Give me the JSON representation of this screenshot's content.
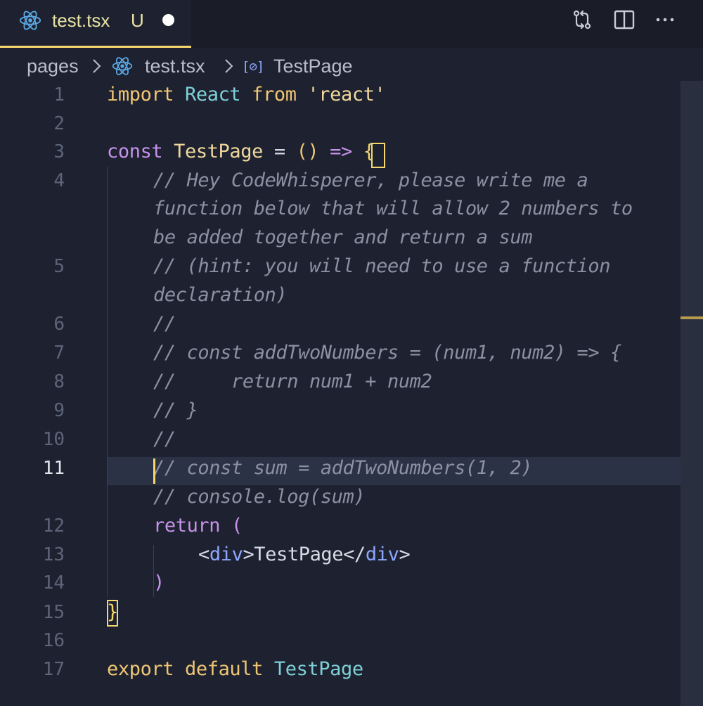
{
  "tab": {
    "filename": "test.tsx",
    "status": "U"
  },
  "breadcrumb": {
    "folder": "pages",
    "file": "test.tsx",
    "symbol": "TestPage",
    "symbol_icon": "[⊘]"
  },
  "toolbar": {
    "compare_icon": "git-compare-icon",
    "split_icon": "split-editor-icon",
    "more_icon": "more-actions-icon"
  },
  "colors": {
    "accent": "#f5d76e",
    "background": "#1e2230",
    "tabbar": "#1a1d27",
    "comment": "#8b91a3"
  },
  "editor": {
    "active_line": "11",
    "lines": [
      {
        "num": "1",
        "tokens": [
          [
            "import",
            "kw"
          ],
          [
            " ",
            "tx"
          ],
          [
            "React",
            "ty"
          ],
          [
            " ",
            "tx"
          ],
          [
            "from",
            "kw"
          ],
          [
            " ",
            "tx"
          ],
          [
            "'react'",
            "st"
          ]
        ]
      },
      {
        "num": "2",
        "tokens": []
      },
      {
        "num": "3",
        "tokens": [
          [
            "const",
            "pl"
          ],
          [
            " ",
            "tx"
          ],
          [
            "TestPage",
            "id"
          ],
          [
            " = ",
            "tx"
          ],
          [
            "()",
            "kw"
          ],
          [
            " => ",
            "pl"
          ],
          [
            "{",
            "br"
          ]
        ]
      },
      {
        "num": "4",
        "tokens": [
          [
            "// Hey CodeWhisperer, please write me a",
            "cm"
          ]
        ]
      },
      {
        "num": "",
        "tokens": [
          [
            "function below that will allow 2 numbers to",
            "cm"
          ]
        ]
      },
      {
        "num": "",
        "tokens": [
          [
            "be added together and return a sum",
            "cm"
          ]
        ]
      },
      {
        "num": "5",
        "tokens": [
          [
            "// (hint: you will need to use a function",
            "cm"
          ]
        ]
      },
      {
        "num": "",
        "tokens": [
          [
            "declaration)",
            "cm"
          ]
        ]
      },
      {
        "num": "6",
        "tokens": [
          [
            "//",
            "cm"
          ]
        ]
      },
      {
        "num": "7",
        "tokens": [
          [
            "// const addTwoNumbers = (num1, num2) => {",
            "cm"
          ]
        ]
      },
      {
        "num": "8",
        "tokens": [
          [
            "//     return num1 + num2",
            "cm"
          ]
        ]
      },
      {
        "num": "9",
        "tokens": [
          [
            "// }",
            "cm"
          ]
        ]
      },
      {
        "num": "10",
        "tokens": [
          [
            "//",
            "cm"
          ]
        ]
      },
      {
        "num": "11",
        "tokens": [
          [
            "// const sum = addTwoNumbers(1, 2)",
            "cm"
          ]
        ]
      },
      {
        "num": "",
        "tokens": [
          [
            "// console.log(sum)",
            "cm"
          ]
        ]
      },
      {
        "num": "12",
        "tokens": [
          [
            "return",
            "pl"
          ],
          [
            " ",
            "tx"
          ],
          [
            "(",
            "pl"
          ]
        ]
      },
      {
        "num": "13",
        "tokens": [
          [
            "<",
            "tx"
          ],
          [
            "div",
            "tg"
          ],
          [
            ">TestPage</",
            "tx"
          ],
          [
            "div",
            "tg"
          ],
          [
            ">",
            "tx"
          ]
        ]
      },
      {
        "num": "14",
        "tokens": [
          [
            ")",
            "pl"
          ]
        ]
      },
      {
        "num": "15",
        "tokens": [
          [
            "}",
            "br"
          ]
        ]
      },
      {
        "num": "16",
        "tokens": []
      },
      {
        "num": "17",
        "tokens": [
          [
            "export",
            "kw"
          ],
          [
            " ",
            "tx"
          ],
          [
            "default",
            "kw"
          ],
          [
            " ",
            "tx"
          ],
          [
            "TestPage",
            "ty"
          ]
        ]
      }
    ]
  }
}
